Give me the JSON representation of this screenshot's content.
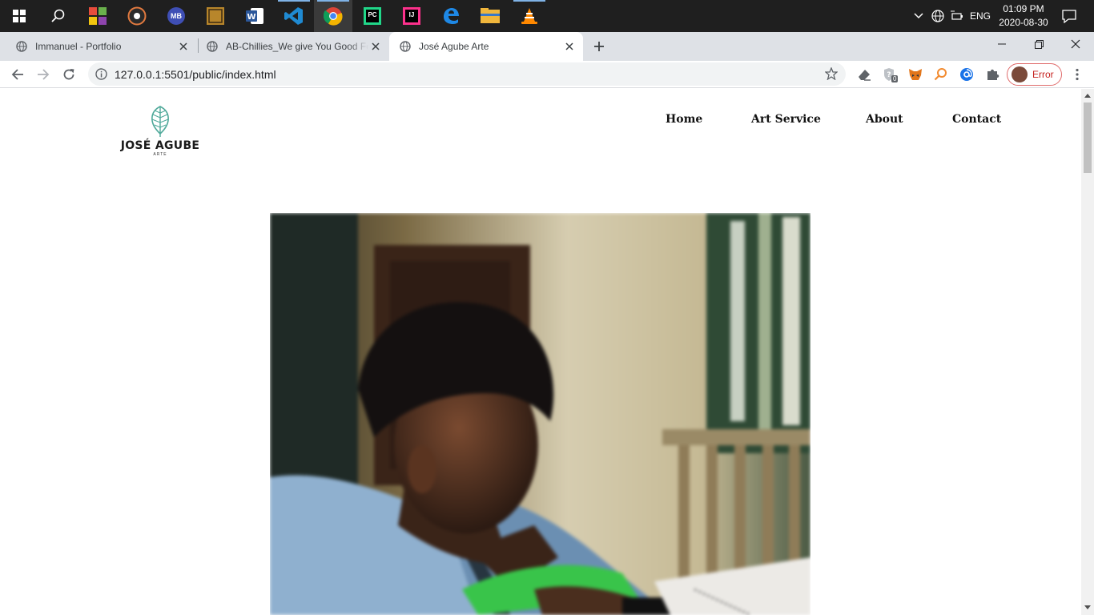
{
  "taskbar": {
    "apps": [
      "start-icon",
      "search-icon",
      "office-icon",
      "groove-icon",
      "mb-icon",
      "dds-icon",
      "word-icon",
      "vscode-icon",
      "chrome-icon",
      "pycharm-icon",
      "intellij-icon",
      "edge-icon",
      "file-explorer-icon",
      "vlc-icon"
    ],
    "mb_label": "MB",
    "pc_label": "PC",
    "ij_label": "IJ",
    "lang": "ENG",
    "time": "01:09 PM",
    "date": "2020-08-30"
  },
  "tabs": [
    {
      "title": "Immanuel - Portfolio"
    },
    {
      "title": "AB-Chillies_We give You Good Food"
    },
    {
      "title": "José Agube Arte"
    }
  ],
  "address": {
    "url": "127.0.0.1:5501/public/index.html"
  },
  "profile": {
    "label": "Error"
  },
  "extensions": {
    "badge": "0"
  },
  "site": {
    "logo_name": "JOSÉ AGUBE",
    "logo_sub": "ARTE",
    "nav": [
      "Home",
      "Art Service",
      "About",
      "Contact"
    ]
  },
  "colors": {
    "logo_leaf": "#4fa99a",
    "taskbar": "#1f1f1f",
    "tabstrip": "#dee1e6"
  }
}
